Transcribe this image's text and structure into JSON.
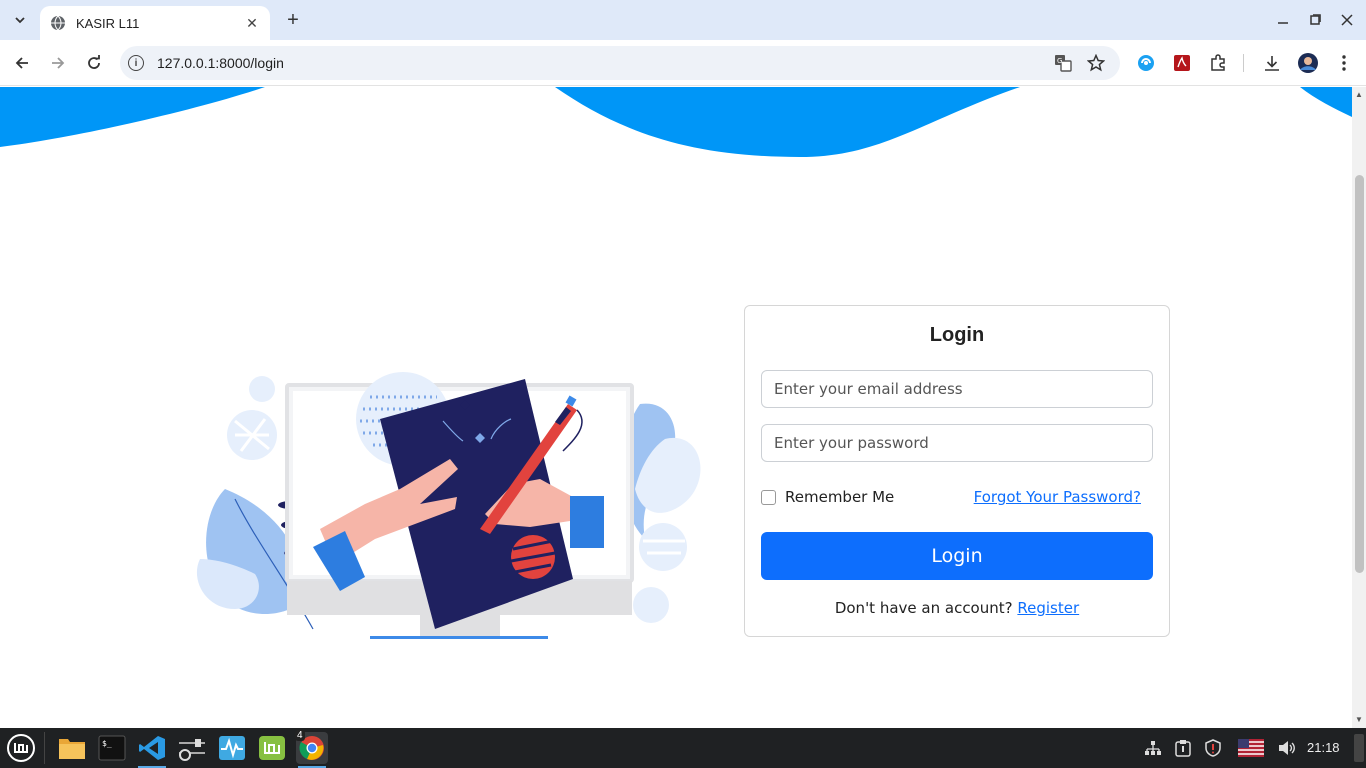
{
  "browser": {
    "tab_title": "KASIR L11",
    "url": "127.0.0.1:8000/login",
    "new_tab_symbol": "+",
    "close_symbol": "✕"
  },
  "login": {
    "title": "Login",
    "email_placeholder": "Enter your email address",
    "password_placeholder": "Enter your password",
    "remember_label": "Remember Me",
    "remember_checked": false,
    "forgot_link": "Forgot Your Password?",
    "submit_label": "Login",
    "register_prompt": "Don't have an account?",
    "register_link": "Register"
  },
  "colors": {
    "brand_blue": "#0096f7",
    "button_blue": "#0d6efd",
    "navy": "#1f2160",
    "accent_red": "#e2433e"
  },
  "taskbar": {
    "apps": [
      "mint-menu-icon",
      "files-icon",
      "terminal-icon",
      "vscode-icon",
      "settings-icon",
      "system-monitor-icon",
      "mint-icon",
      "chrome-icon"
    ],
    "chrome_badge": "4",
    "clock": "21:18"
  }
}
